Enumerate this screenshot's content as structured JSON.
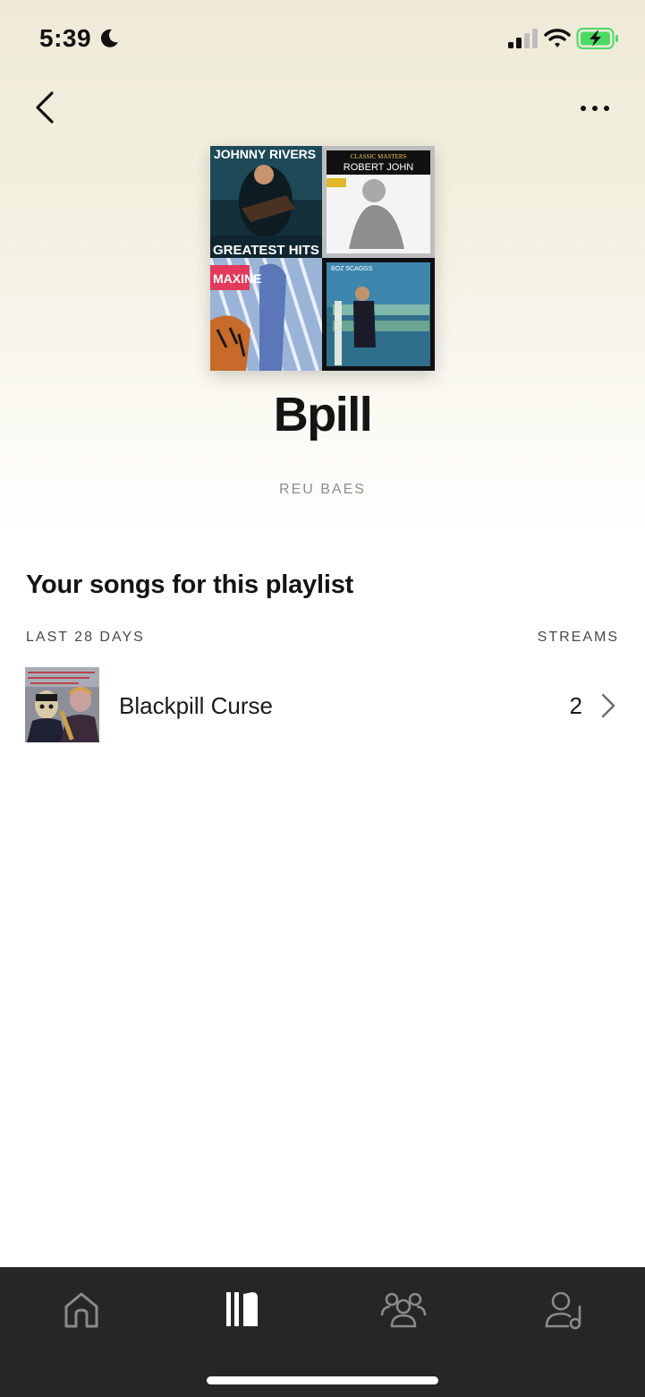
{
  "status_bar": {
    "time": "5:39",
    "icons": [
      "moon-icon",
      "cellular-signal-icon",
      "wifi-icon",
      "battery-charging-icon"
    ],
    "battery_color": "#4cd964"
  },
  "header": {
    "back_icon": "chevron-left-icon",
    "more_icon": "more-horizontal-icon"
  },
  "playlist": {
    "title": "Bpill",
    "owner": "REU BAES",
    "cover_tiles": [
      {
        "top_text": "JOHNNY RIVERS",
        "bottom_text": "GREATEST HITS"
      },
      {
        "top_text": "CLASSIC MASTERS",
        "bottom_text": "ROBERT JOHN"
      },
      {
        "top_text": "MAXINE",
        "bottom_text": ""
      },
      {
        "top_text": "BOZ SCAGGS",
        "bottom_text": ""
      }
    ]
  },
  "songs_section": {
    "title": "Your songs for this playlist",
    "period_label": "LAST 28 DAYS",
    "streams_label": "STREAMS",
    "tracks": [
      {
        "name": "Blackpill Curse",
        "streams": "2"
      }
    ]
  },
  "tab_bar": {
    "tabs": [
      {
        "icon": "home-icon"
      },
      {
        "icon": "library-icon",
        "active": true
      },
      {
        "icon": "audience-icon"
      },
      {
        "icon": "profile-music-icon"
      }
    ],
    "background": "#262626"
  }
}
